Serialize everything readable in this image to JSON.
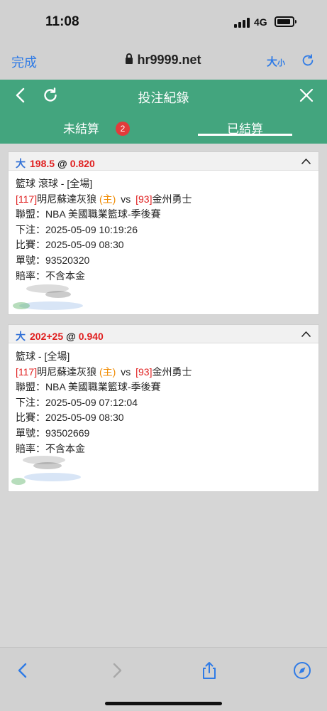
{
  "status_bar": {
    "time": "11:08",
    "network": "4G"
  },
  "browser": {
    "done_label": "完成",
    "url": "hr9999.net",
    "text_size_big": "大",
    "text_size_small": "小",
    "accent_color": "#2f7be6"
  },
  "header": {
    "title": "投注紀錄",
    "color": "#43a57e"
  },
  "tabs": {
    "unsettled_label": "未結算",
    "unsettled_count": "2",
    "settled_label": "已結算",
    "active": "已結算"
  },
  "bets": [
    {
      "type": "大",
      "line": "198.5",
      "at": "@",
      "odds": "0.820",
      "sport": "籃球 滾球 - [全場]",
      "home_id": "[117]",
      "home_team": "明尼蘇達灰狼",
      "home_mark": "(主)",
      "vs": "vs",
      "away_id": "[93]",
      "away_team": "金州勇士",
      "league": "聯盟：NBA 美國職業籃球-季後賽",
      "bet_time": "下注：2025-05-09 10:19:26",
      "match_time": "比賽：2025-05-09 08:30",
      "ticket": "單號：93520320",
      "odds_note": "賠率：不含本金"
    },
    {
      "type": "大",
      "line": "202+25",
      "at": "@",
      "odds": "0.940",
      "sport": "籃球 - [全場]",
      "home_id": "[117]",
      "home_team": "明尼蘇達灰狼",
      "home_mark": "(主)",
      "vs": "vs",
      "away_id": "[93]",
      "away_team": "金州勇士",
      "league": "聯盟：NBA 美國職業籃球-季後賽",
      "bet_time": "下注：2025-05-09 07:12:04",
      "match_time": "比賽：2025-05-09 08:30",
      "ticket": "單號：93502669",
      "odds_note": "賠率：不含本金"
    }
  ],
  "toolbar_icons": [
    "back-icon",
    "forward-icon",
    "share-icon",
    "compass-icon"
  ]
}
